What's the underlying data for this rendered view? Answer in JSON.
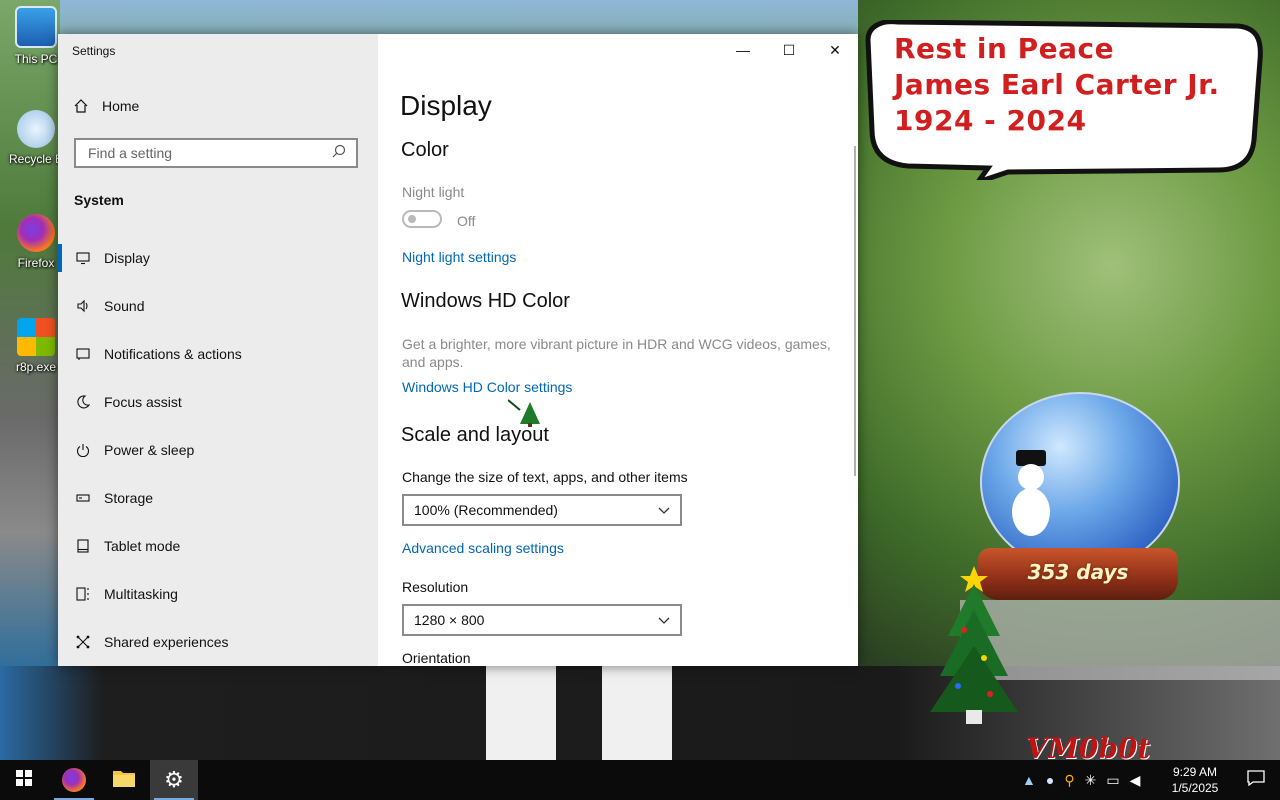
{
  "desktop": {
    "icons": [
      {
        "label": "This PC"
      },
      {
        "label": "Recycle B"
      },
      {
        "label": "Firefox"
      },
      {
        "label": "r8p.exe"
      }
    ],
    "bubble_lines": [
      "Rest in Peace",
      "James Earl Carter Jr.",
      "1924 - 2024"
    ],
    "globe_days": "353 days",
    "watermark": "VM0b0t"
  },
  "window": {
    "title": "Settings",
    "controls": {
      "minimize": "—",
      "maximize": "☐",
      "close": "✕"
    }
  },
  "sidebar": {
    "home_label": "Home",
    "search_placeholder": "Find a setting",
    "section": "System",
    "items": [
      {
        "label": "Display",
        "icon": "monitor-icon"
      },
      {
        "label": "Sound",
        "icon": "speaker-icon"
      },
      {
        "label": "Notifications & actions",
        "icon": "notifications-icon"
      },
      {
        "label": "Focus assist",
        "icon": "moon-icon"
      },
      {
        "label": "Power & sleep",
        "icon": "power-icon"
      },
      {
        "label": "Storage",
        "icon": "storage-icon"
      },
      {
        "label": "Tablet mode",
        "icon": "tablet-icon"
      },
      {
        "label": "Multitasking",
        "icon": "multitasking-icon"
      },
      {
        "label": "Shared experiences",
        "icon": "shared-icon"
      }
    ]
  },
  "content": {
    "title": "Display",
    "color_heading": "Color",
    "night_light_label": "Night light",
    "night_light_state": "Off",
    "night_light_link": "Night light settings",
    "hd_heading": "Windows HD Color",
    "hd_desc_line1": "Get a brighter, more vibrant picture in HDR and WCG videos, games,",
    "hd_desc_line2": "and apps.",
    "hd_link": "Windows HD Color settings",
    "scale_heading": "Scale and layout",
    "scale_label": "Change the size of text, apps, and other items",
    "scale_value": "100% (Recommended)",
    "advanced_link": "Advanced scaling settings",
    "resolution_label": "Resolution",
    "resolution_value": "1280 × 800",
    "orientation_label": "Orientation"
  },
  "taskbar": {
    "clock_time": "9:29 AM",
    "clock_date": "1/5/2025"
  },
  "colors": {
    "accent": "#0067c0",
    "link": "#0067b8",
    "sidebar_bg": "#ececec",
    "taskbar_bg": "#0b0b0b"
  }
}
